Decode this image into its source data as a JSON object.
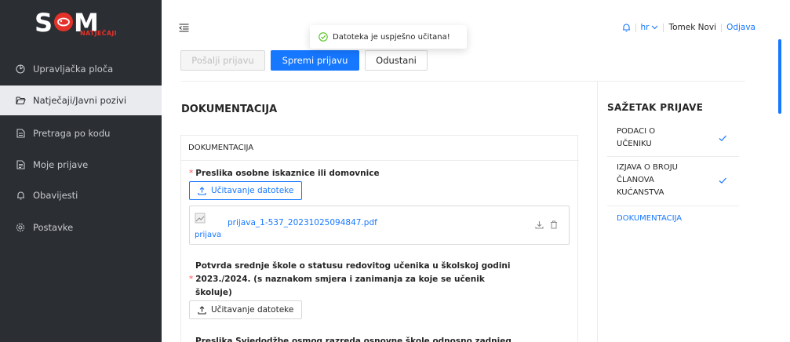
{
  "brand": {
    "logo_text": "S M",
    "sub": "NATJEČAJI",
    "accent": "#e4322b"
  },
  "sidebar": {
    "items": [
      {
        "label": "Upravljačka ploča",
        "icon": "dashboard-icon"
      },
      {
        "label": "Natječaji/Javni pozivi",
        "icon": "folder-open-icon",
        "active": true
      },
      {
        "label": "Pretraga po kodu",
        "icon": "file-icon"
      },
      {
        "label": "Moje prijave",
        "icon": "file-text-icon"
      },
      {
        "label": "Obavijesti",
        "icon": "bell-icon"
      },
      {
        "label": "Postavke",
        "icon": "gear-icon"
      }
    ]
  },
  "header": {
    "language": "hr",
    "user_name": "Tomek Novi",
    "logout_label": "Odjava"
  },
  "toast": {
    "message": "Datoteka je uspješno učitana!"
  },
  "toolbar": {
    "submit_label": "Pošalji prijavu",
    "save_label": "Spremi prijavu",
    "cancel_label": "Odustani"
  },
  "main": {
    "section_title": "DOKUMENTACIJA",
    "card_title": "DOKUMENTACIJA",
    "fields": [
      {
        "label": "Preslika osobne iskaznice ili domovnice",
        "upload_label": "Učitavanje datoteke",
        "file": {
          "name": "prijava_1-537_20231025094847.pdf",
          "thumb_alt": "prijava"
        }
      },
      {
        "label_line1": "Potvrda srednje škole o statusu redovitog učenika u školskoj godini",
        "label_line2": "2023./2024. (s naznakom smjera i zanimanja za koje se učenik",
        "label_line3": "školuje)",
        "upload_label": "Učitavanje datoteke"
      },
      {
        "label": "Preslika Svjedodžbe osmog razreda osnovne škole odnosno zadnjeg"
      }
    ]
  },
  "summary": {
    "title": "SAŽETAK PRIJAVE",
    "items": [
      {
        "line1": "PODACI O",
        "line2": "UČENIKU",
        "done": true
      },
      {
        "line1": "IZJAVA O BROJU",
        "line2": "ČLANOVA",
        "line3": "KUĆANSTVA",
        "done": true
      },
      {
        "line1": "DOKUMENTACIJA",
        "current": true
      }
    ]
  },
  "colors": {
    "primary": "#1677ff",
    "sidebar_bg": "#2b2e33",
    "success": "#52c41a",
    "required": "#ff4d4f"
  }
}
